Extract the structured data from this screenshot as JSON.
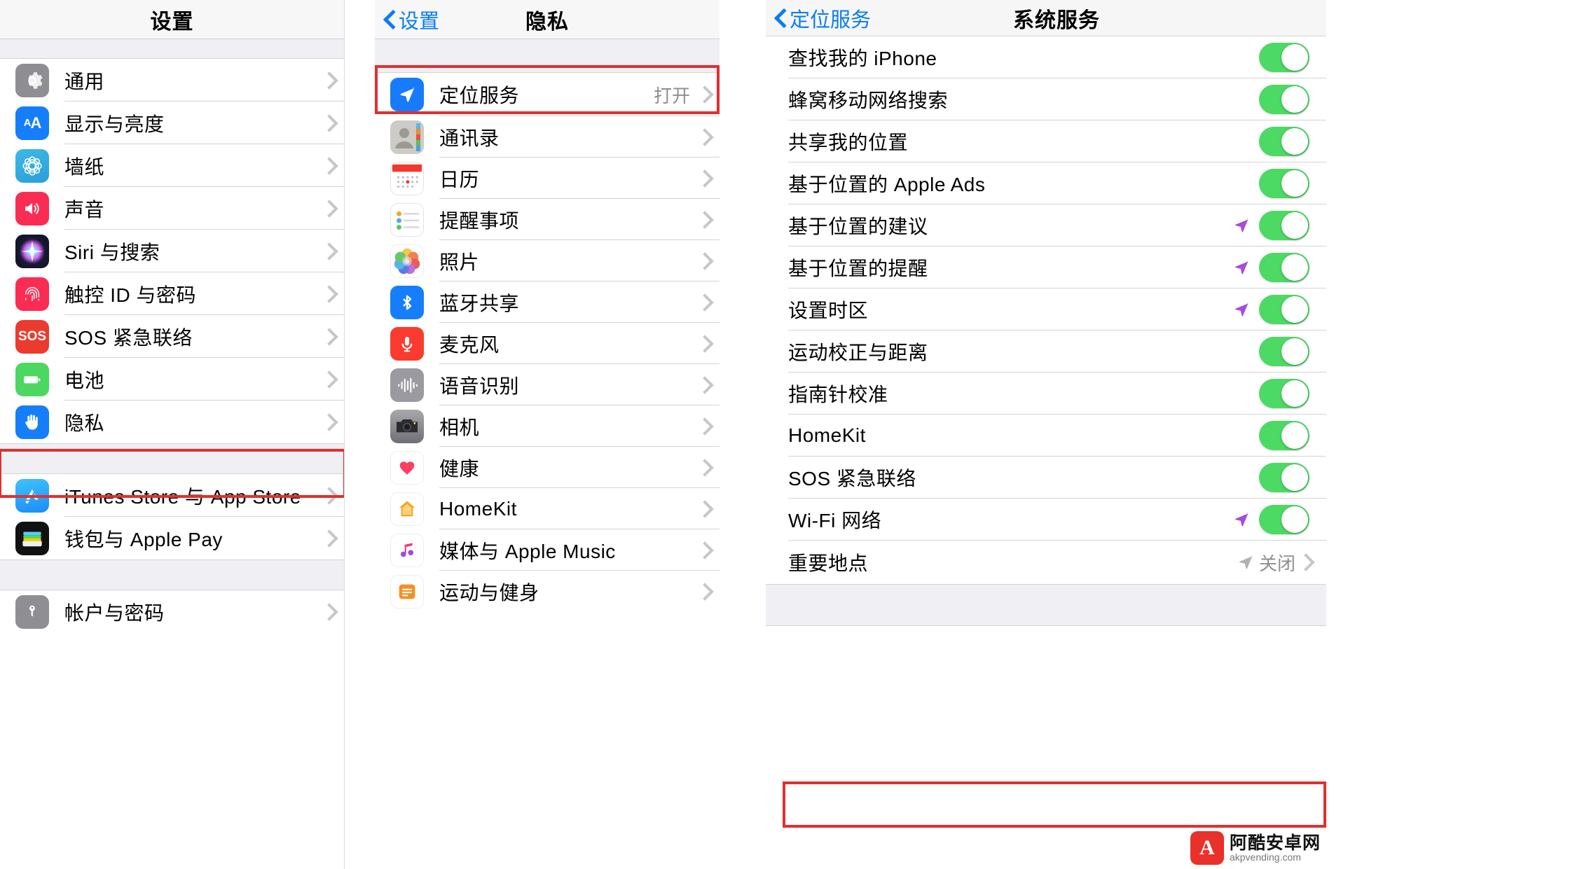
{
  "left_panel": {
    "title": "设置",
    "groups": [
      {
        "items": [
          {
            "label": "通用",
            "icon": "gear-icon"
          },
          {
            "label": "显示与亮度",
            "icon": "display-brightness-icon"
          },
          {
            "label": "墙纸",
            "icon": "wallpaper-icon"
          },
          {
            "label": "声音",
            "icon": "sound-icon"
          },
          {
            "label": "Siri 与搜索",
            "icon": "siri-icon"
          },
          {
            "label": "触控 ID 与密码",
            "icon": "touchid-icon"
          },
          {
            "label": "SOS 紧急联络",
            "icon": "sos-icon"
          },
          {
            "label": "电池",
            "icon": "battery-icon"
          },
          {
            "label": "隐私",
            "icon": "privacy-hand-icon",
            "highlighted": true
          }
        ]
      },
      {
        "items": [
          {
            "label": "iTunes Store 与 App Store",
            "icon": "appstore-icon"
          },
          {
            "label": "钱包与 Apple Pay",
            "icon": "wallet-icon"
          }
        ]
      },
      {
        "items": [
          {
            "label": "帐户与密码",
            "icon": "accounts-passwords-icon"
          }
        ]
      }
    ]
  },
  "mid_panel": {
    "back_label": "设置",
    "title": "隐私",
    "items": [
      {
        "label": "定位服务",
        "icon": "location-services-icon",
        "value": "打开",
        "highlighted": true
      },
      {
        "label": "通讯录",
        "icon": "contacts-icon",
        "value": ""
      },
      {
        "label": "日历",
        "icon": "calendar-icon",
        "value": ""
      },
      {
        "label": "提醒事项",
        "icon": "reminders-icon",
        "value": ""
      },
      {
        "label": "照片",
        "icon": "photos-icon",
        "value": ""
      },
      {
        "label": "蓝牙共享",
        "icon": "bluetooth-icon",
        "value": ""
      },
      {
        "label": "麦克风",
        "icon": "microphone-icon",
        "value": ""
      },
      {
        "label": "语音识别",
        "icon": "speech-recognition-icon",
        "value": ""
      },
      {
        "label": "相机",
        "icon": "camera-icon",
        "value": ""
      },
      {
        "label": "健康",
        "icon": "health-icon",
        "value": ""
      },
      {
        "label": "HomeKit",
        "icon": "homekit-icon",
        "value": ""
      },
      {
        "label": "媒体与 Apple Music",
        "icon": "music-icon",
        "value": ""
      },
      {
        "label": "运动与健身",
        "icon": "fitness-icon",
        "value": ""
      }
    ]
  },
  "right_panel": {
    "back_label": "定位服务",
    "title": "系统服务",
    "items": [
      {
        "label": "查找我的 iPhone",
        "control": "toggle",
        "state": "on",
        "arrow": false
      },
      {
        "label": "蜂窝移动网络搜索",
        "control": "toggle",
        "state": "on",
        "arrow": false
      },
      {
        "label": "共享我的位置",
        "control": "toggle",
        "state": "on",
        "arrow": false
      },
      {
        "label": "基于位置的 Apple Ads",
        "control": "toggle",
        "state": "on",
        "arrow": false
      },
      {
        "label": "基于位置的建议",
        "control": "toggle",
        "state": "on",
        "arrow": true
      },
      {
        "label": "基于位置的提醒",
        "control": "toggle",
        "state": "on",
        "arrow": true
      },
      {
        "label": "设置时区",
        "control": "toggle",
        "state": "on",
        "arrow": true
      },
      {
        "label": "运动校正与距离",
        "control": "toggle",
        "state": "on",
        "arrow": false
      },
      {
        "label": "指南针校准",
        "control": "toggle",
        "state": "on",
        "arrow": false
      },
      {
        "label": "HomeKit",
        "control": "toggle",
        "state": "on",
        "arrow": false
      },
      {
        "label": "SOS 紧急联络",
        "control": "toggle",
        "state": "on",
        "arrow": false
      },
      {
        "label": "Wi-Fi 网络",
        "control": "toggle",
        "state": "on",
        "arrow": true
      },
      {
        "label": "重要地点",
        "control": "disclosure",
        "value": "关闭",
        "arrow": true,
        "highlighted": true
      }
    ]
  },
  "watermark": {
    "logo_letter": "A",
    "name": "阿酷安卓网",
    "domain": "akpvending.com"
  },
  "colors": {
    "accent_blue": "#0a7cf3",
    "toggle_green": "#4cd964",
    "highlight_red": "#e03030",
    "group_bg": "#efeff4",
    "secondary_text": "#8e8e93"
  }
}
